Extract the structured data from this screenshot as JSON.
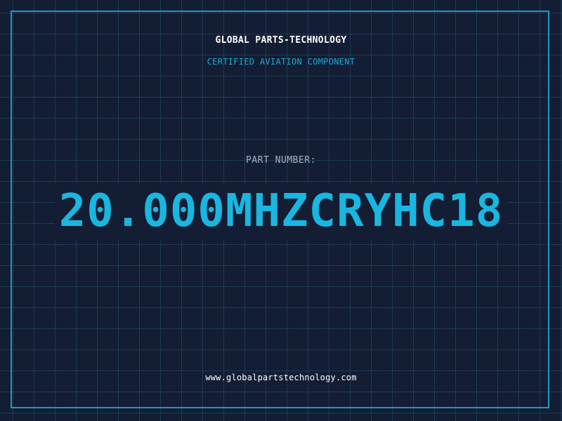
{
  "header": {
    "company": "GLOBAL PARTS-TECHNOLOGY",
    "tagline": "CERTIFIED AVIATION COMPONENT"
  },
  "part": {
    "label": "PART NUMBER:",
    "number": "20.000MHZCRYHC18"
  },
  "footer": {
    "website": "www.globalpartstechnology.com"
  },
  "colors": {
    "background": "#131d33",
    "grid": "#1f3b56",
    "accent": "#19b7e0",
    "frame": "#1a9cc4"
  }
}
